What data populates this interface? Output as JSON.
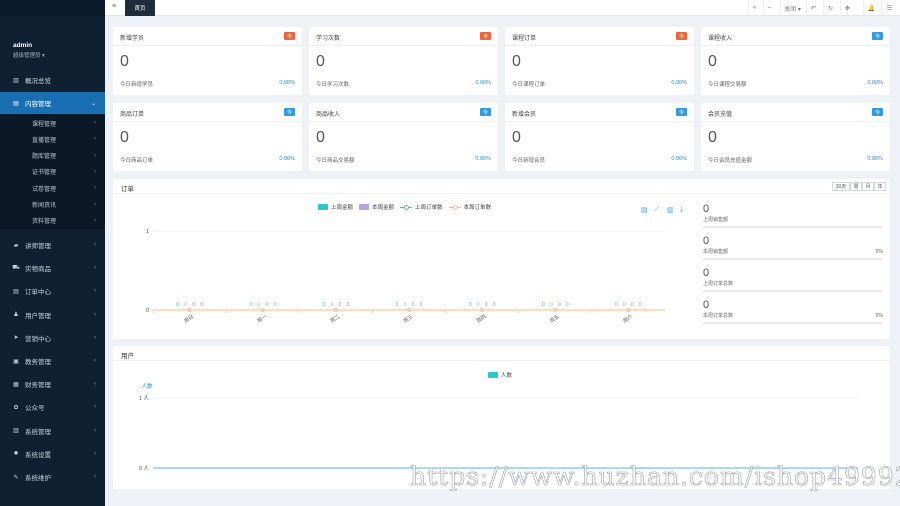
{
  "topbar": {
    "menu_icon": "hamburger-icon",
    "home_tab": "首页",
    "tools": [
      {
        "name": "nav-first-button",
        "glyph": "«"
      },
      {
        "name": "nav-refresh-tabs-button",
        "glyph": "⇔"
      },
      {
        "name": "close-tabs-dropdown",
        "glyph": "关闭 ▾"
      },
      {
        "name": "undo-button",
        "glyph": "↶"
      },
      {
        "name": "refresh-button",
        "glyph": "↻"
      },
      {
        "name": "fullscreen-button",
        "glyph": "✥"
      },
      {
        "name": "notification-bell",
        "glyph": "🔔"
      },
      {
        "name": "settings-button",
        "glyph": "☰"
      }
    ],
    "notification_count": "6"
  },
  "user": {
    "name": "admin",
    "role": "超级管理员 ▾"
  },
  "sidebar": {
    "home": {
      "label": "概况总览",
      "icon": "bank-icon"
    },
    "content": {
      "label": "内容管理",
      "icon": "book-icon",
      "chevron": "⌄"
    },
    "sub_items": [
      {
        "label": "课程管理"
      },
      {
        "label": "直播管理"
      },
      {
        "label": "题库管理"
      },
      {
        "label": "证书管理"
      },
      {
        "label": "试卷管理"
      },
      {
        "label": "新闻资讯"
      },
      {
        "label": "资料管理"
      }
    ],
    "items": [
      {
        "label": "讲师管理",
        "icon": "flag-icon",
        "glyph": "▰"
      },
      {
        "label": "实物商品",
        "icon": "cart-icon",
        "glyph": "⛟"
      },
      {
        "label": "订单中心",
        "icon": "list-icon",
        "glyph": "▤"
      },
      {
        "label": "用户管理",
        "icon": "user-icon",
        "glyph": "♟"
      },
      {
        "label": "营销中心",
        "icon": "send-icon",
        "glyph": "➤"
      },
      {
        "label": "教务管理",
        "icon": "book-open-icon",
        "glyph": "▣"
      },
      {
        "label": "财务管理",
        "icon": "money-icon",
        "glyph": "▦"
      },
      {
        "label": "公众号",
        "icon": "wechat-icon",
        "glyph": "✿"
      },
      {
        "label": "系统管理",
        "icon": "grid-icon",
        "glyph": "▥"
      },
      {
        "label": "系统设置",
        "icon": "gear-icon",
        "glyph": "✹"
      },
      {
        "label": "系统维护",
        "icon": "wrench-icon",
        "glyph": "✎"
      }
    ],
    "chevron": "‹"
  },
  "cards": [
    {
      "title": "新增学员",
      "tag": "今",
      "tag_color": "#f0643a",
      "value": "0",
      "sub": "今日新增学员",
      "pct": "0.00%"
    },
    {
      "title": "学习次数",
      "tag": "今",
      "tag_color": "#f0643a",
      "value": "0",
      "sub": "今日学习次数",
      "pct": "0.00%"
    },
    {
      "title": "课程订单",
      "tag": "今",
      "tag_color": "#f0643a",
      "value": "0",
      "sub": "今日课程订单",
      "pct": "0.00%"
    },
    {
      "title": "课程收入",
      "tag": "今",
      "tag_color": "#2f9be8",
      "value": "0",
      "sub": "今日课程交易额",
      "pct": "0.00%"
    },
    {
      "title": "商品订单",
      "tag": "今",
      "tag_color": "#2f9be8",
      "value": "0",
      "sub": "今日商品订单",
      "pct": "0.00%"
    },
    {
      "title": "商品收入",
      "tag": "今",
      "tag_color": "#2f9be8",
      "value": "0",
      "sub": "今日商品交易额",
      "pct": "0.00%"
    },
    {
      "title": "新增会员",
      "tag": "今",
      "tag_color": "#2f9be8",
      "value": "0",
      "sub": "今日新增会员",
      "pct": "0.00%"
    },
    {
      "title": "会员充值",
      "tag": "今",
      "tag_color": "#2f9be8",
      "value": "0",
      "sub": "今日会员充值金额",
      "pct": "0.00%"
    }
  ],
  "order_panel": {
    "title": "订单",
    "ranges": [
      "30天",
      "周",
      "月",
      "年"
    ],
    "toolbox_icons": [
      "data-view-icon",
      "line-switch-icon",
      "bar-switch-icon",
      "download-icon"
    ],
    "stats": [
      {
        "value": "0",
        "label": "上周销售额",
        "pct": ""
      },
      {
        "value": "0",
        "label": "本周销售额",
        "pct": "0%"
      },
      {
        "value": "0",
        "label": "上周订单总数",
        "pct": ""
      },
      {
        "value": "0",
        "label": "本周订单总数",
        "pct": "0%"
      }
    ]
  },
  "user_panel": {
    "title": "用户"
  },
  "chart_data": [
    {
      "type": "bar",
      "categories": [
        "周日",
        "周一",
        "周二",
        "周三",
        "周四",
        "周五",
        "周六"
      ],
      "series": [
        {
          "name": "上周金额",
          "kind": "bar",
          "color": "#2ec7c9",
          "values": [
            0,
            0,
            0,
            0,
            0,
            0,
            0
          ]
        },
        {
          "name": "本周金额",
          "kind": "bar",
          "color": "#b6a2de",
          "values": [
            0,
            0,
            0,
            0,
            0,
            0,
            0
          ]
        },
        {
          "name": "上周订单数",
          "kind": "line",
          "color": "#5ab1ef",
          "values": [
            0,
            0,
            0,
            0,
            0,
            0,
            0
          ]
        },
        {
          "name": "本周订单数",
          "kind": "line",
          "color": "#ffb980",
          "values": [
            0,
            0,
            0,
            0,
            0,
            0,
            0
          ]
        }
      ],
      "ylim": [
        0,
        1
      ],
      "yticks": [
        "0",
        "1"
      ],
      "legend": "top-center"
    },
    {
      "type": "line",
      "series": [
        {
          "name": "人数",
          "color": "#2ec7c9",
          "values": [
            0
          ]
        }
      ],
      "ylabel": "人数",
      "yticks": [
        "0 人",
        "1 人"
      ],
      "ylim": [
        0,
        1
      ],
      "legend": "top-center"
    }
  ],
  "watermark": "https://www.huzhan.com/ishop49992"
}
